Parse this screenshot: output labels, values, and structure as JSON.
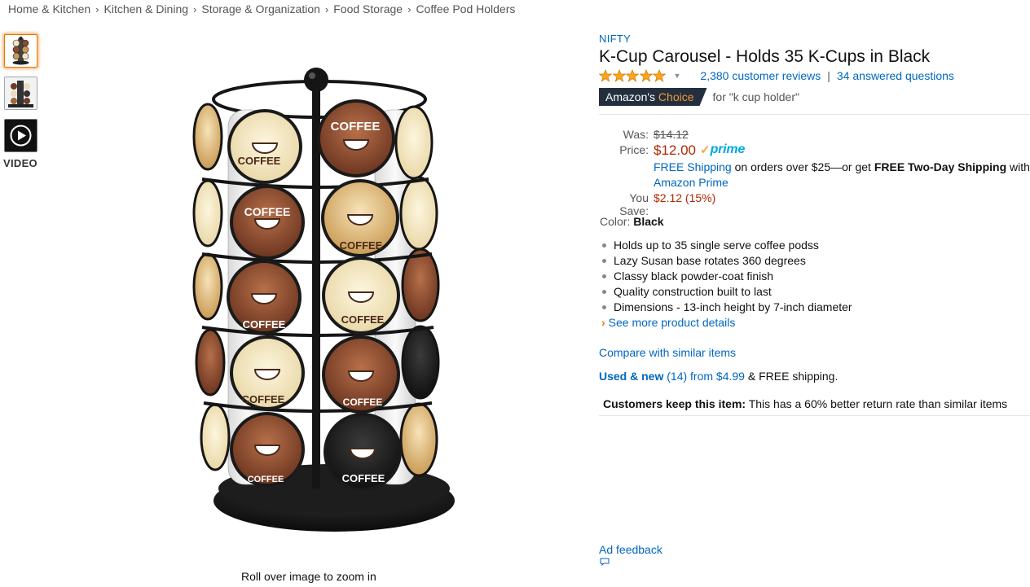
{
  "breadcrumb": {
    "items": [
      "Home & Kitchen",
      "Kitchen & Dining",
      "Storage & Organization",
      "Food Storage",
      "Coffee Pod Holders"
    ],
    "separator": "›"
  },
  "gallery": {
    "video_label": "VIDEO",
    "zoom_hint": "Roll over image to zoom in",
    "pod_label": "COFFEE"
  },
  "product": {
    "brand": "NIFTY",
    "title": "K-Cup Carousel - Holds 35 K-Cups in Black",
    "rating_stars": 5,
    "reviews_link": "2,380 customer reviews",
    "reviews_separator": "|",
    "questions_link": "34 answered questions",
    "badge": {
      "prefix": "Amazon's",
      "word": "Choice"
    },
    "badge_for": "for \"k cup holder\""
  },
  "pricing": {
    "was_label": "Was:",
    "was_value": "$14.12",
    "price_label": "Price:",
    "price_value": "$12.00",
    "prime_word": "prime",
    "free_shipping_link": "FREE Shipping",
    "shipping_text": " on orders over $25—or get ",
    "two_day_text": "FREE Two-Day Shipping",
    "with_text": " with",
    "amazon_prime_link": "Amazon Prime",
    "save_label": "You Save:",
    "save_value": "$2.12 (15%)"
  },
  "color": {
    "label": "Color: ",
    "value": "Black"
  },
  "features": [
    "Holds up to 35 single serve coffee podss",
    "Lazy Susan base rotates 360 degrees",
    "Classy black powder-coat finish",
    "Quality construction built to last",
    "Dimensions - 13-inch height by 7-inch diameter"
  ],
  "see_more": "See more product details",
  "compare_link": "Compare with similar items",
  "offers": {
    "used_new": "Used & new",
    "count": " (14) from $4.99",
    "rest": " & FREE shipping."
  },
  "keep": {
    "bold": "Customers keep this item:",
    "text": " This has a 60% better return rate than similar items"
  },
  "ad_feedback": "Ad feedback",
  "colors": {
    "link": "#0066c0",
    "price": "#b12704",
    "badge_bg": "#232f3e",
    "badge_accent": "#f69931",
    "prime_blue": "#00a8e1",
    "star": "#ffa41c"
  }
}
